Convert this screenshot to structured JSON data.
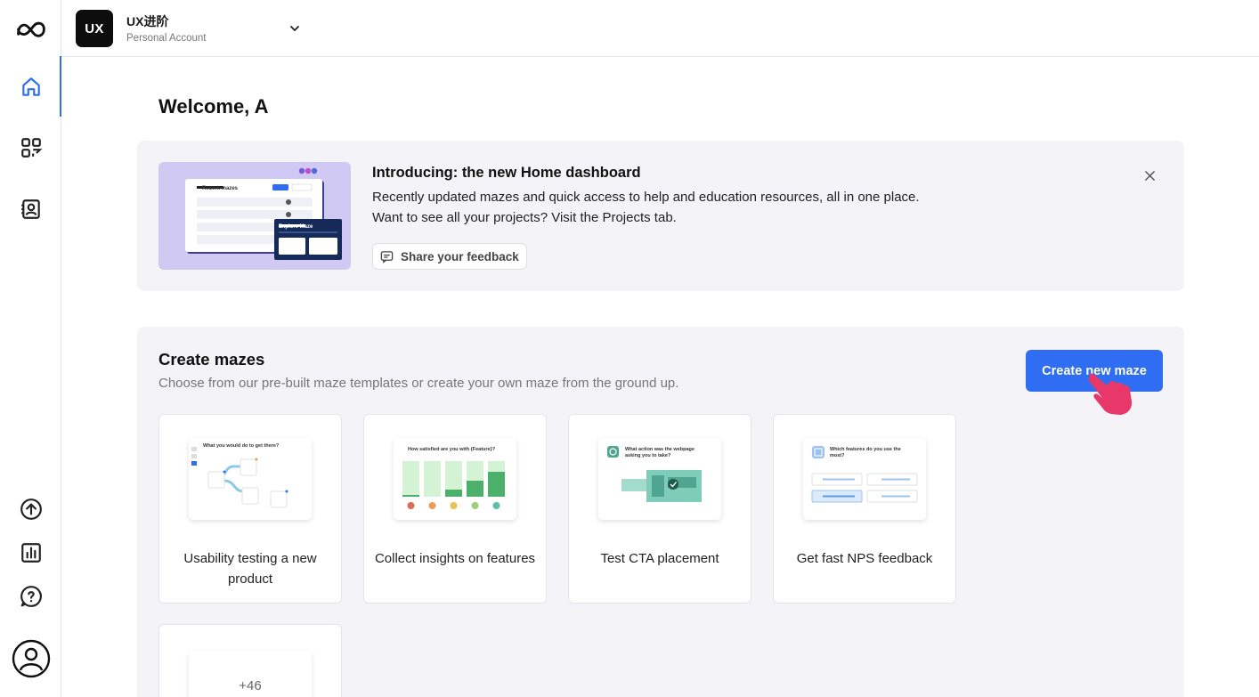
{
  "sidebar": {
    "items": [
      {
        "icon": "maze-logo-icon"
      },
      {
        "icon": "home-icon",
        "active": true
      },
      {
        "icon": "projects-grid-icon"
      },
      {
        "icon": "contacts-icon"
      },
      {
        "icon": "upgrade-arrow-icon"
      },
      {
        "icon": "analytics-icon"
      },
      {
        "icon": "help-icon"
      },
      {
        "icon": "user-avatar-icon"
      }
    ],
    "accent": "#2e6ef0"
  },
  "workspace": {
    "logo_text": "UX",
    "name": "UX进阶",
    "account_type": "Personal Account"
  },
  "welcome": "Welcome, A",
  "banner": {
    "title": "Introducing: the new Home dashboard",
    "line1": "Recently updated mazes and quick access to help and education resources, all in one place.",
    "line2": "Want to see all your projects? Visit the Projects tab.",
    "feedback_label": "Share your feedback",
    "art": {
      "panel_title": "Recent mazes",
      "popup_title": "Explore Maze"
    }
  },
  "create": {
    "title": "Create mazes",
    "subtitle": "Choose from our pre-built maze templates or create your own maze from the ground up.",
    "button_label": "Create new maze",
    "button_color": "#2f6ef2",
    "templates": [
      {
        "label": "Usability testing a new product",
        "thumb_text": "What you would do to get there?"
      },
      {
        "label": "Collect insights on features",
        "thumb_text": "How satisfied are you with {Feature}?"
      },
      {
        "label": "Test CTA placement",
        "thumb_text": "What action was the webpage asking you to take?"
      },
      {
        "label": "Get fast NPS feedback",
        "thumb_text": "Which features do you use the most?"
      }
    ],
    "more_label": "+46"
  }
}
